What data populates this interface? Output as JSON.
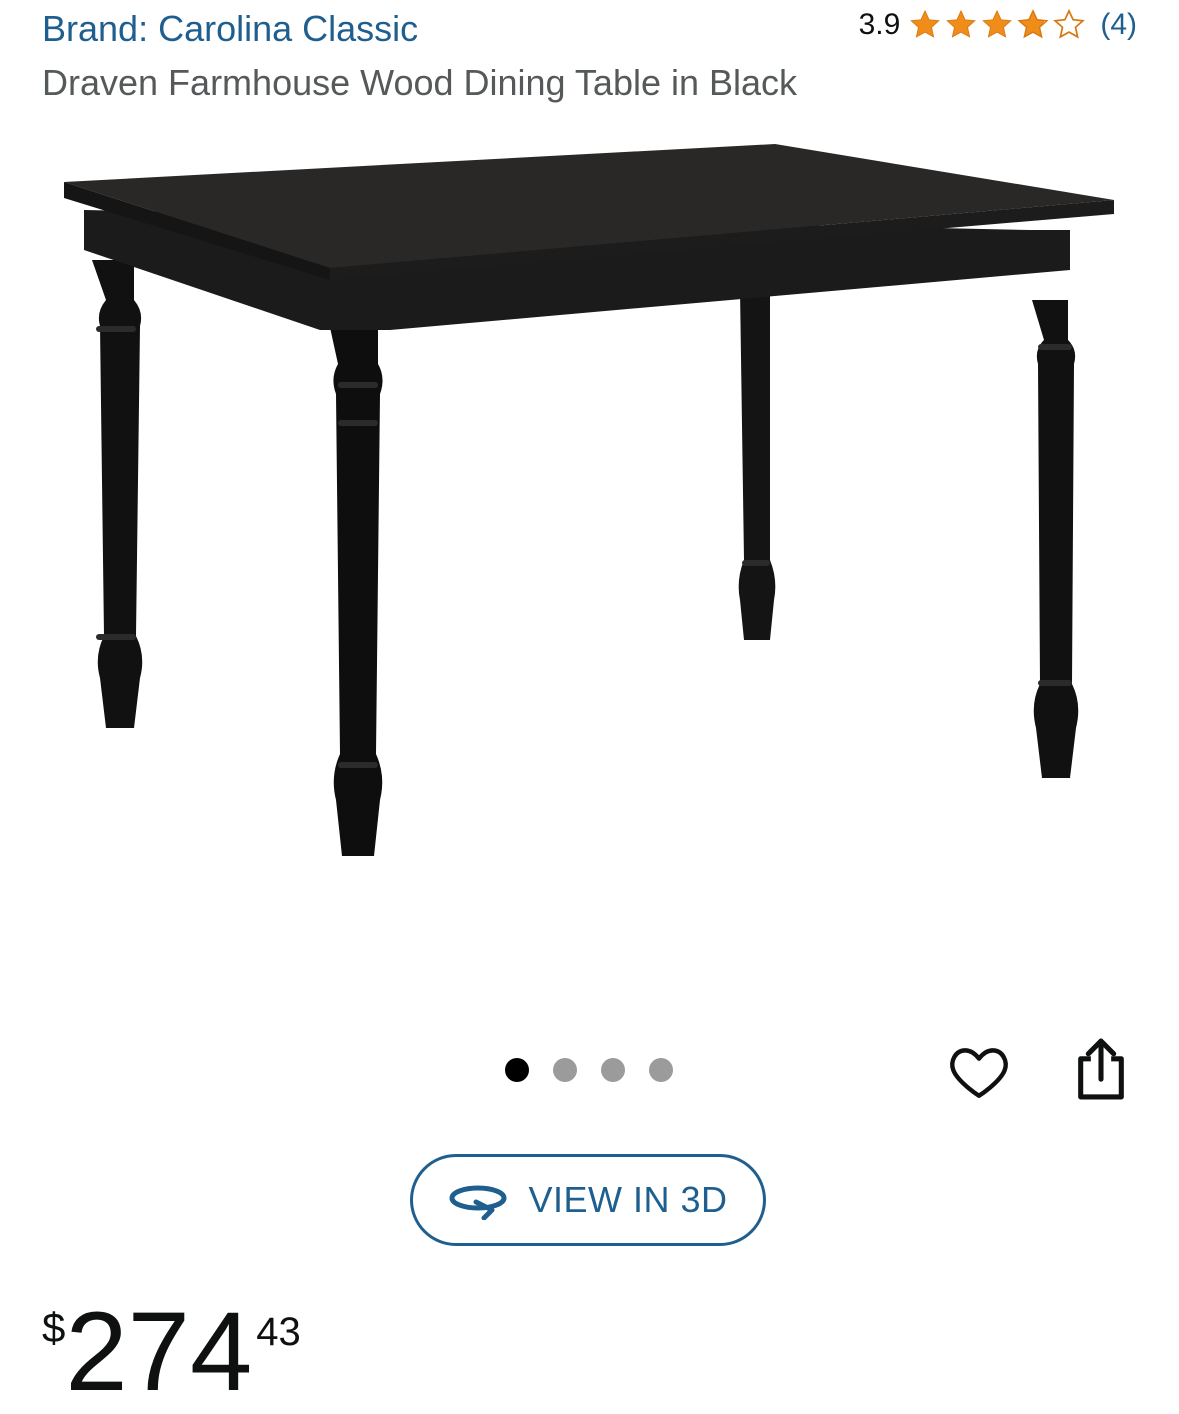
{
  "header": {
    "brand_label": "Brand: Carolina Classic",
    "rating_value": "3.9",
    "stars": 3.9,
    "rating_count": "(4)",
    "star_color": "#f08c19"
  },
  "product": {
    "title": "Draven Farmhouse Wood Dining Table in Black",
    "image_icon": "dining-table-image"
  },
  "carousel": {
    "total": 4,
    "active_index": 0
  },
  "actions": {
    "wishlist_icon": "heart-icon",
    "share_icon": "share-icon"
  },
  "view3d": {
    "label": "VIEW IN 3D",
    "icon": "rotate-3d-icon"
  },
  "price": {
    "symbol": "$",
    "whole": "274",
    "fraction": "43"
  },
  "colors": {
    "link": "#1f5f8f",
    "text_secondary": "#565959",
    "dot_inactive": "#9b9b9b",
    "dot_active": "#000000"
  }
}
